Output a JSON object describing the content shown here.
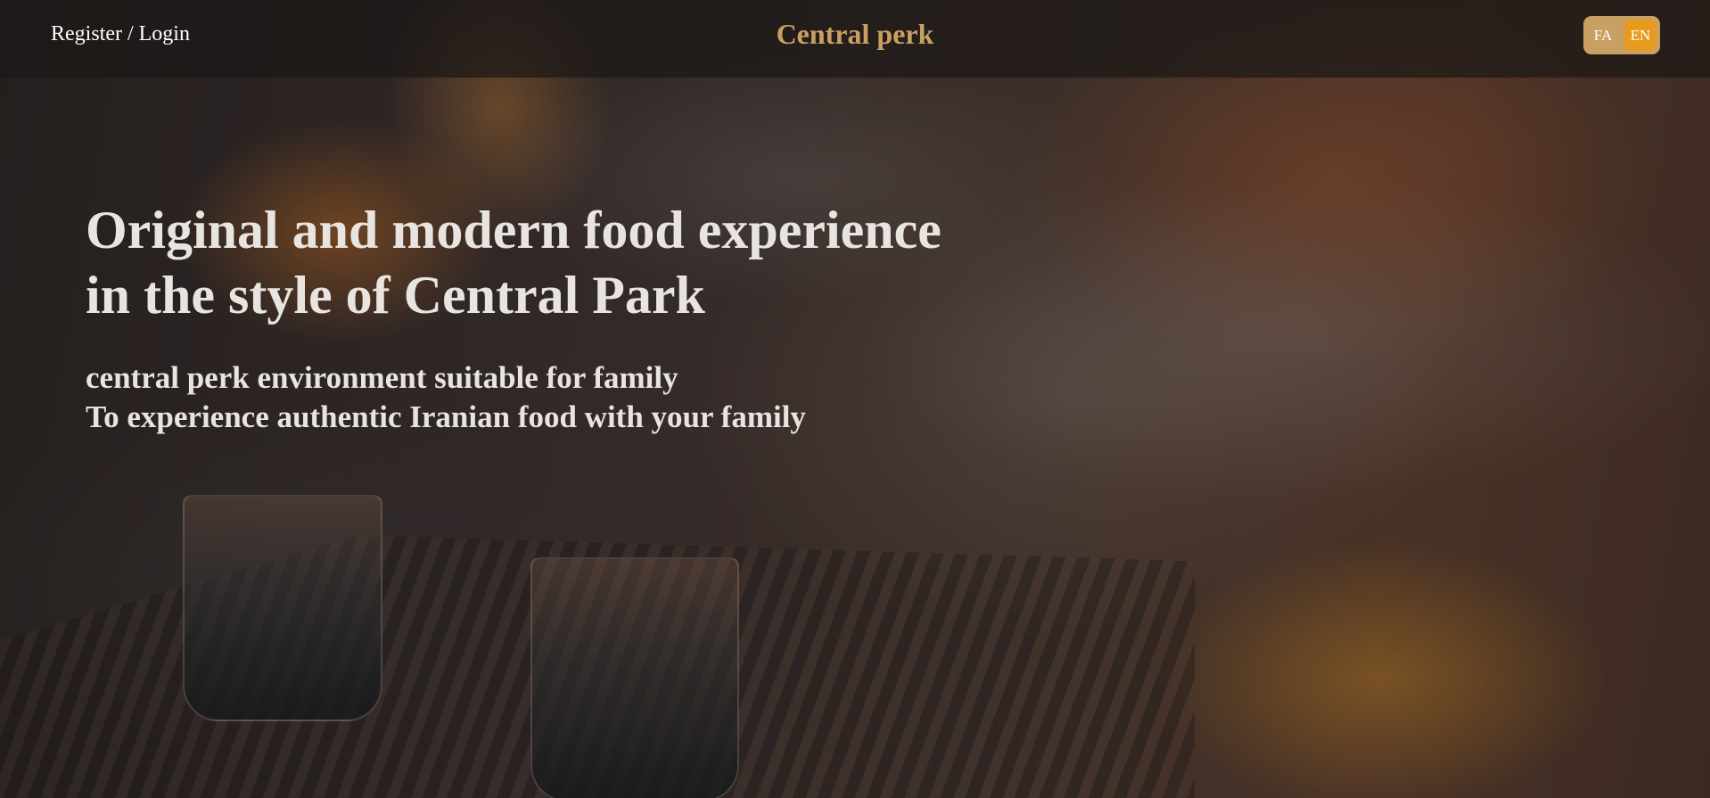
{
  "header": {
    "auth_link": "Register / Login",
    "brand": "Central perk",
    "languages": [
      {
        "code": "FA",
        "active": false
      },
      {
        "code": "EN",
        "active": true
      }
    ]
  },
  "hero": {
    "title_lines": [
      "Original and modern food experience",
      "in the style of Central Park"
    ],
    "subtitle_lines": [
      "central perk environment suitable for family",
      "To experience authentic Iranian food with your family"
    ]
  },
  "colors": {
    "brand_gold": "#c9a063",
    "active_language": "#e89a1f",
    "nav_background": "rgba(28,24,22,0.72)",
    "hero_text": "#e8e4e0"
  }
}
